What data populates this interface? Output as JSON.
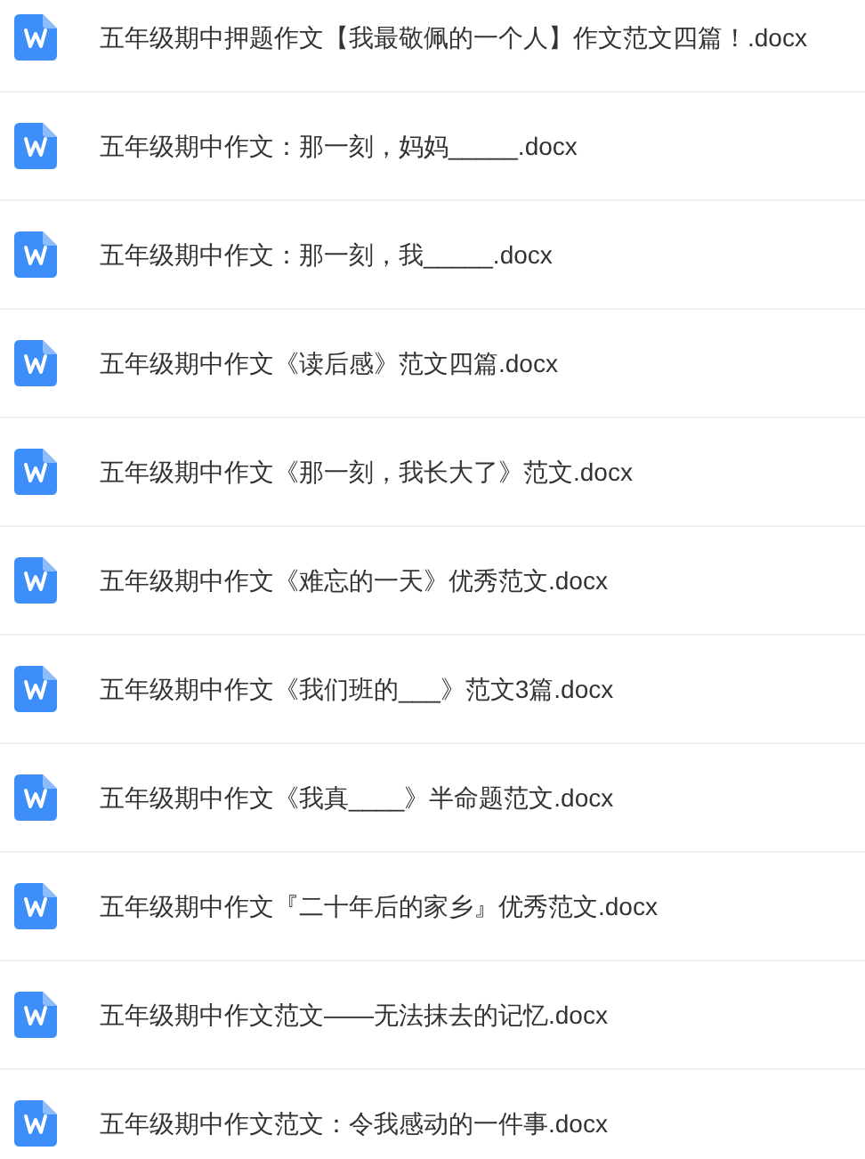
{
  "files": [
    {
      "name": "五年级期中押题作文【我最敬佩的一个人】作文范文四篇！.docx"
    },
    {
      "name": "五年级期中作文：那一刻，妈妈_____.docx"
    },
    {
      "name": "五年级期中作文：那一刻，我_____.docx"
    },
    {
      "name": "五年级期中作文《读后感》范文四篇.docx"
    },
    {
      "name": "五年级期中作文《那一刻，我长大了》范文.docx"
    },
    {
      "name": "五年级期中作文《难忘的一天》优秀范文.docx"
    },
    {
      "name": "五年级期中作文《我们班的___》范文3篇.docx"
    },
    {
      "name": "五年级期中作文《我真____》半命题范文.docx"
    },
    {
      "name": "五年级期中作文『二十年后的家乡』优秀范文.docx"
    },
    {
      "name": "五年级期中作文范文——无法抹去的记忆.docx"
    },
    {
      "name": "五年级期中作文范文：令我感动的一件事.docx"
    }
  ]
}
